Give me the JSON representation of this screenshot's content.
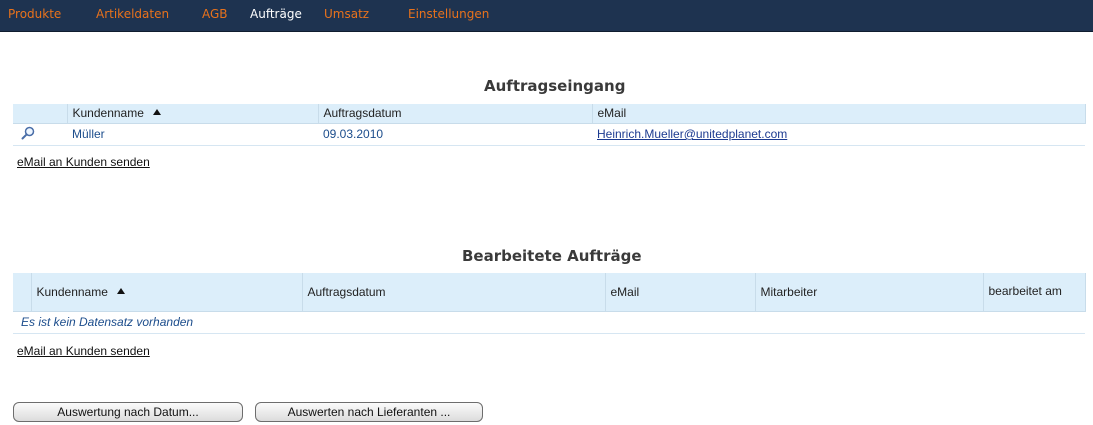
{
  "nav": {
    "items": [
      {
        "label": "Produkte"
      },
      {
        "label": "Artikeldaten"
      },
      {
        "label": "AGB"
      },
      {
        "label": "Aufträge"
      },
      {
        "label": "Umsatz"
      },
      {
        "label": "Einstellungen"
      }
    ],
    "active_index": 3,
    "colors": {
      "background": "#1e3350",
      "inactive": "#e8721c",
      "active": "#ffffff"
    }
  },
  "auftragseingang": {
    "title": "Auftragseingang",
    "columns": [
      "Kundenname",
      "Auftragsdatum",
      "eMail"
    ],
    "sort_column": "Kundenname",
    "sort_direction": "ascending",
    "rows": [
      {
        "kundenname": "Müller",
        "auftragsdatum": "09.03.2010",
        "email": "Heinrich.Mueller@unitedplanet.com"
      }
    ],
    "send_link": "eMail an Kunden senden"
  },
  "bearbeitete": {
    "title": "Bearbeitete Aufträge",
    "columns": [
      "Kundenname",
      "Auftragsdatum",
      "eMail",
      "Mitarbeiter",
      "bearbeitet am"
    ],
    "sort_column": "Kundenname",
    "sort_direction": "ascending",
    "empty_message": "Es ist kein Datensatz vorhanden",
    "send_link": "eMail an Kunden senden"
  },
  "buttons": {
    "by_date": "Auswertung nach Datum...",
    "by_supplier": "Auswerten nach Lieferanten ..."
  },
  "colors": {
    "header_bg": "#dceefa",
    "link": "#1c3a90",
    "accent": "#e8721c"
  }
}
